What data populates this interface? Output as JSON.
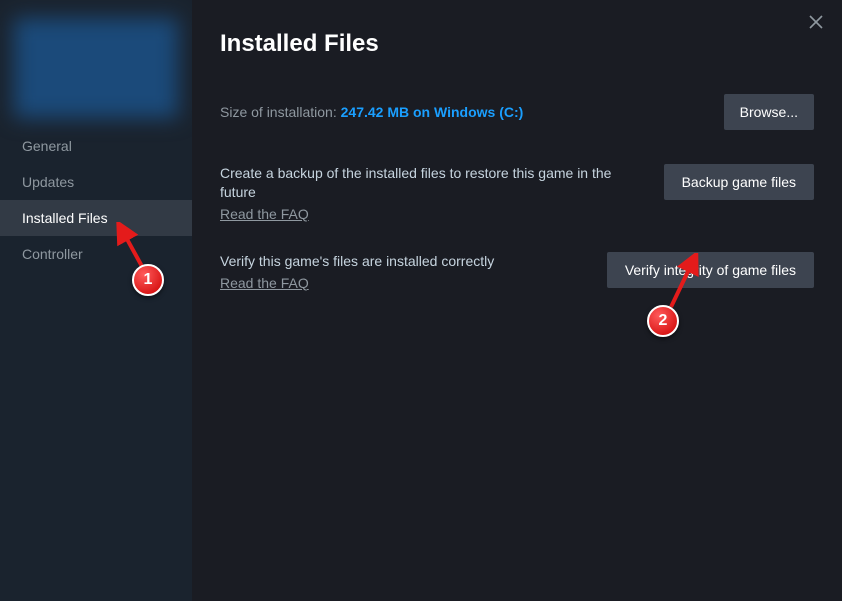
{
  "sidebar": {
    "items": [
      {
        "label": "General"
      },
      {
        "label": "Updates"
      },
      {
        "label": "Installed Files"
      },
      {
        "label": "Controller"
      }
    ]
  },
  "header": {
    "title": "Installed Files"
  },
  "install": {
    "size_label": "Size of installation: ",
    "size_value": "247.42 MB on Windows (C:)",
    "browse_label": "Browse..."
  },
  "backup": {
    "desc": "Create a backup of the installed files to restore this game in the future",
    "faq": "Read the FAQ",
    "button": "Backup game files"
  },
  "verify": {
    "desc": "Verify this game's files are installed correctly",
    "faq": "Read the FAQ",
    "button": "Verify integrity of game files"
  },
  "annotations": {
    "badge1": "1",
    "badge2": "2"
  }
}
